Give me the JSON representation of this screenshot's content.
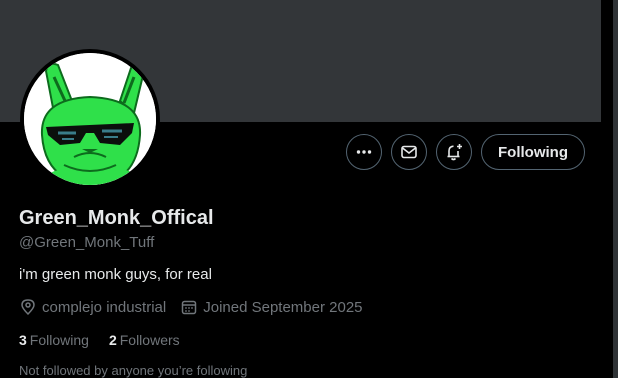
{
  "profile": {
    "display_name": "Green_Monk_Offical",
    "handle": "@Green_Monk_Tuff",
    "bio": "i'm green monk guys, for real",
    "location": "complejo industrial",
    "joined": "Joined September 2025",
    "following_count": "3",
    "following_label": "Following",
    "followers_count": "2",
    "followers_label": "Followers",
    "followed_by_note": "Not followed by anyone you’re following"
  },
  "actions": {
    "more_icon": "more-icon",
    "message_icon": "mail-icon",
    "notify_icon": "bell-plus-icon",
    "follow_label": "Following"
  },
  "colors": {
    "banner": "#333639",
    "background": "#000000",
    "primary_text": "#e7e9ea",
    "secondary_text": "#71767b",
    "avatar_green": "#2fe04a"
  }
}
